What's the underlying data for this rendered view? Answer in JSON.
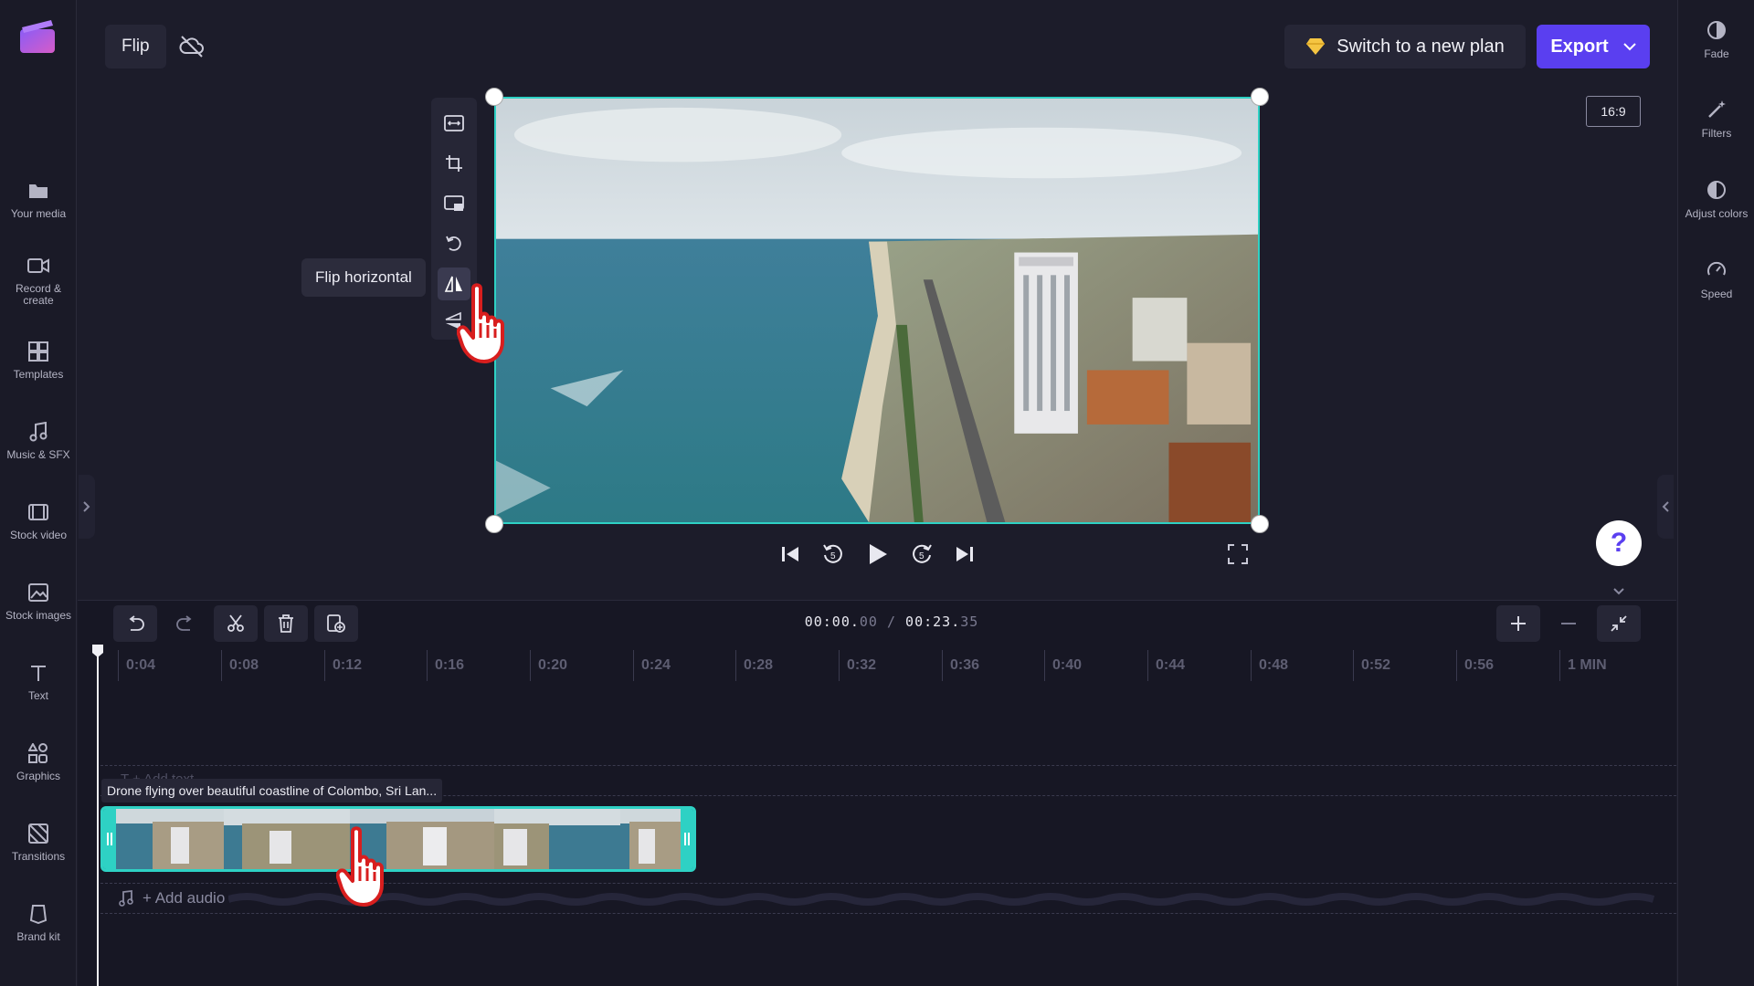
{
  "project": {
    "title": "Flip"
  },
  "header": {
    "upgrade_label": "Switch to a new plan",
    "export_label": "Export"
  },
  "left_sidebar": {
    "items": [
      {
        "label": "Your media",
        "icon": "folder-icon"
      },
      {
        "label": "Record & create",
        "icon": "camera-icon"
      },
      {
        "label": "Templates",
        "icon": "templates-icon"
      },
      {
        "label": "Music & SFX",
        "icon": "music-note-icon"
      },
      {
        "label": "Stock video",
        "icon": "film-icon"
      },
      {
        "label": "Stock images",
        "icon": "image-icon"
      },
      {
        "label": "Text",
        "icon": "text-icon"
      },
      {
        "label": "Graphics",
        "icon": "shapes-icon"
      },
      {
        "label": "Transitions",
        "icon": "transitions-icon"
      },
      {
        "label": "Brand kit",
        "icon": "brand-kit-icon"
      }
    ]
  },
  "right_sidebar": {
    "items": [
      {
        "label": "Fade",
        "icon": "fade-icon"
      },
      {
        "label": "Filters",
        "icon": "magic-wand-icon"
      },
      {
        "label": "Adjust colors",
        "icon": "contrast-icon"
      },
      {
        "label": "Speed",
        "icon": "speedometer-icon"
      }
    ]
  },
  "preview": {
    "aspect_ratio": "16:9",
    "tooltip": "Flip horizontal"
  },
  "timeline": {
    "current_time_main": "00:00.",
    "current_time_frac": "00",
    "separator": "/",
    "total_time_main": "00:23.",
    "total_time_frac": "35",
    "ruler_ticks": [
      "0:04",
      "0:08",
      "0:12",
      "0:16",
      "0:20",
      "0:24",
      "0:28",
      "0:32",
      "0:36",
      "0:40",
      "0:44",
      "0:48",
      "0:52",
      "0:56",
      "1 MIN"
    ],
    "clip_title": "Drone flying over beautiful coastline of Colombo, Sri Lan...",
    "text_track_hint": "T  + Add text",
    "add_audio_label": "+ Add audio"
  },
  "colors": {
    "accent": "#5a3ff0",
    "selection": "#2ed1c4",
    "background": "#1c1c2a"
  }
}
